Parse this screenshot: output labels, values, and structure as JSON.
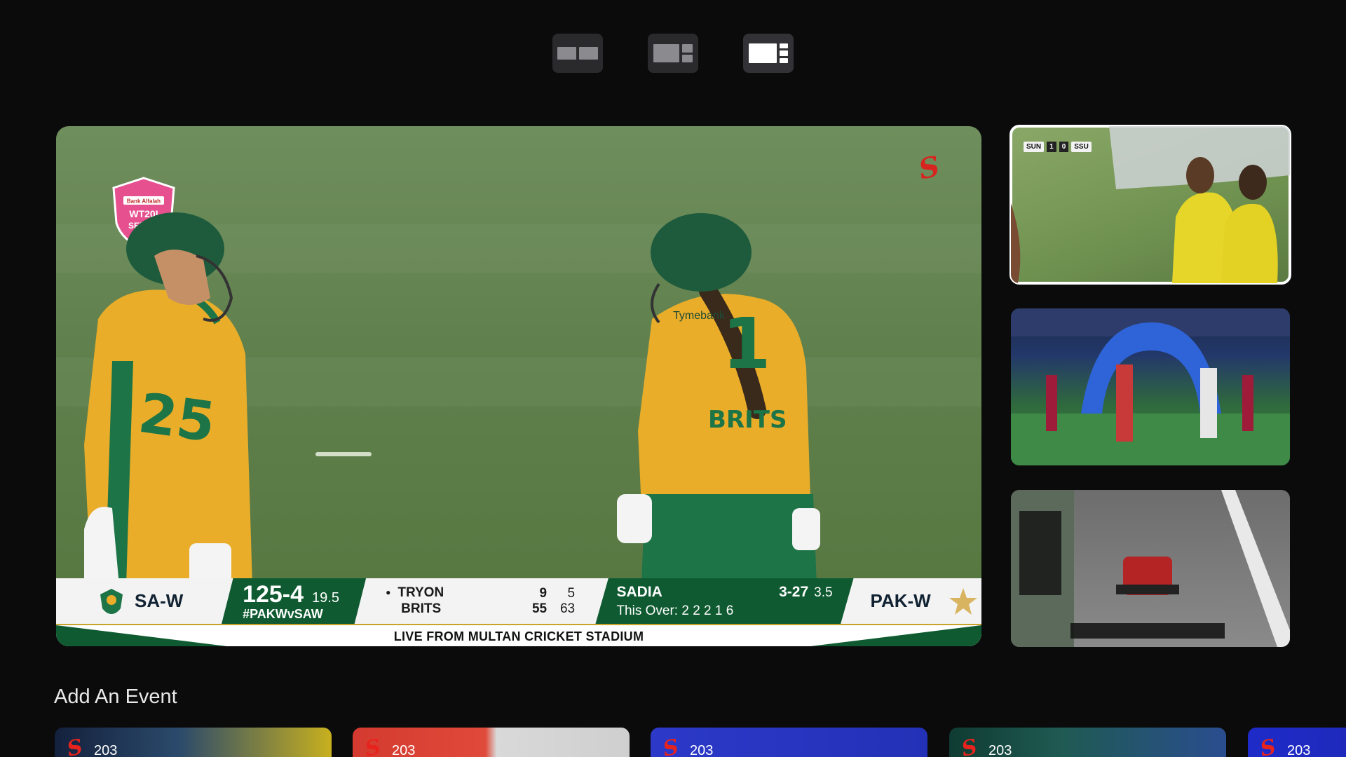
{
  "layout_options": [
    {
      "name": "split-two"
    },
    {
      "name": "main-plus-two"
    },
    {
      "name": "main-plus-three",
      "active": true
    }
  ],
  "main_stream": {
    "broadcaster_logo": "S",
    "series_badge": {
      "sponsor": "Bank Alfalah",
      "line1": "WT20I",
      "line2": "SERIES"
    },
    "jersey_left": {
      "number": "25"
    },
    "jersey_right": {
      "number": "1",
      "name": "BRITS",
      "sponsor": "Tymebank"
    },
    "scoreboard": {
      "home_team": "SA-W",
      "score": "125-4",
      "overs": "19.5",
      "hashtag": "#PAKWvSAW",
      "batters": [
        {
          "name": "TRYON",
          "runs": "9",
          "balls": "5",
          "on_strike": true
        },
        {
          "name": "BRITS",
          "runs": "55",
          "balls": "63",
          "on_strike": false
        }
      ],
      "bowler": {
        "name": "SADIA",
        "figures": "3-27",
        "overs": "3.5"
      },
      "this_over_label": "This Over:",
      "this_over": "2 2 2 1 6",
      "away_team": "PAK-W",
      "live_text": "LIVE FROM MULTAN CRICKET STADIUM"
    }
  },
  "side_streams": [
    {
      "name": "football-match",
      "selected": true,
      "score": {
        "home": "SUN",
        "home_goals": "1",
        "away_goals": "0",
        "away": "SSU"
      }
    },
    {
      "name": "champions-league-walkout",
      "selected": false
    },
    {
      "name": "f1-race",
      "selected": false
    }
  ],
  "add_event": {
    "title": "Add An Event",
    "cards": [
      {
        "channel": "203",
        "bg": "linear-gradient(90deg,#14213d 0%,#2b4a6b 45%,#c7b01f 100%)"
      },
      {
        "channel": "203",
        "bg": "linear-gradient(90deg,#d43a2f 0%,#e04a3a 48%,#d9d9d9 52%,#cfcfcf 100%)"
      },
      {
        "channel": "203",
        "bg": "linear-gradient(90deg,#2c39c9 0%,#2331b7 100%)"
      },
      {
        "channel": "203",
        "bg": "linear-gradient(90deg,#0f3b32 0%,#1f5a52 40%,#2a4d8f 100%)"
      },
      {
        "channel": "203",
        "bg": "linear-gradient(90deg,#1f2bc8 0%,#1b26a6 100%)"
      }
    ]
  },
  "colors": {
    "background": "#0b0b0c",
    "accent_green": "#0f5a31",
    "brand_red": "#e8231d"
  }
}
